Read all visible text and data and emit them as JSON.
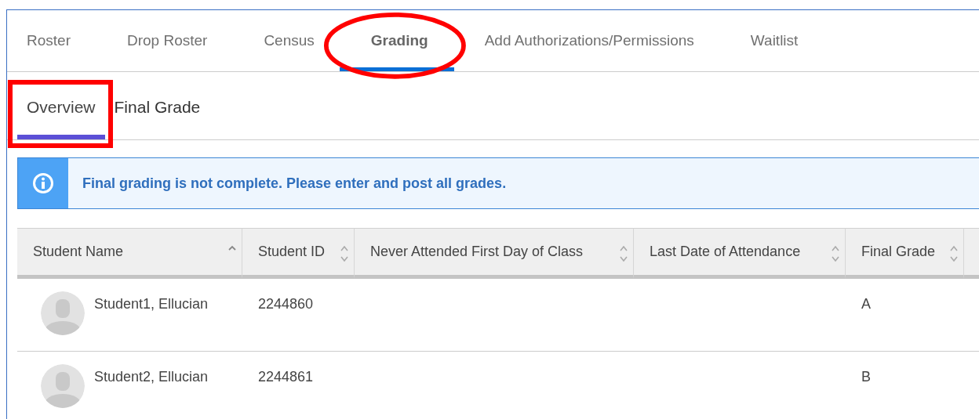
{
  "tabs": [
    {
      "label": "Roster",
      "selected": false,
      "circled": false
    },
    {
      "label": "Drop Roster",
      "selected": false,
      "circled": false
    },
    {
      "label": "Census",
      "selected": false,
      "circled": false
    },
    {
      "label": "Grading",
      "selected": true,
      "circled": true
    },
    {
      "label": "Add Authorizations/Permissions",
      "selected": false,
      "circled": false
    },
    {
      "label": "Waitlist",
      "selected": false,
      "circled": false
    }
  ],
  "subtabs": [
    {
      "label": "Overview",
      "selected": true,
      "boxed": true
    },
    {
      "label": "Final Grade",
      "selected": false,
      "boxed": false
    }
  ],
  "alert": {
    "message": "Final grading is not complete. Please enter and post all grades."
  },
  "table": {
    "columns": [
      {
        "label": "Student Name",
        "sorted": true
      },
      {
        "label": "Student ID",
        "sorted": false
      },
      {
        "label": "Never Attended First Day of Class",
        "sorted": false
      },
      {
        "label": "Last Date of Attendance",
        "sorted": false
      },
      {
        "label": "Final Grade",
        "sorted": false
      }
    ],
    "rows": [
      {
        "name": "Student1, Ellucian",
        "student_id": "2244860",
        "final_grade": "A"
      },
      {
        "name": "Student2, Ellucian",
        "student_id": "2244861",
        "final_grade": "B"
      }
    ]
  }
}
